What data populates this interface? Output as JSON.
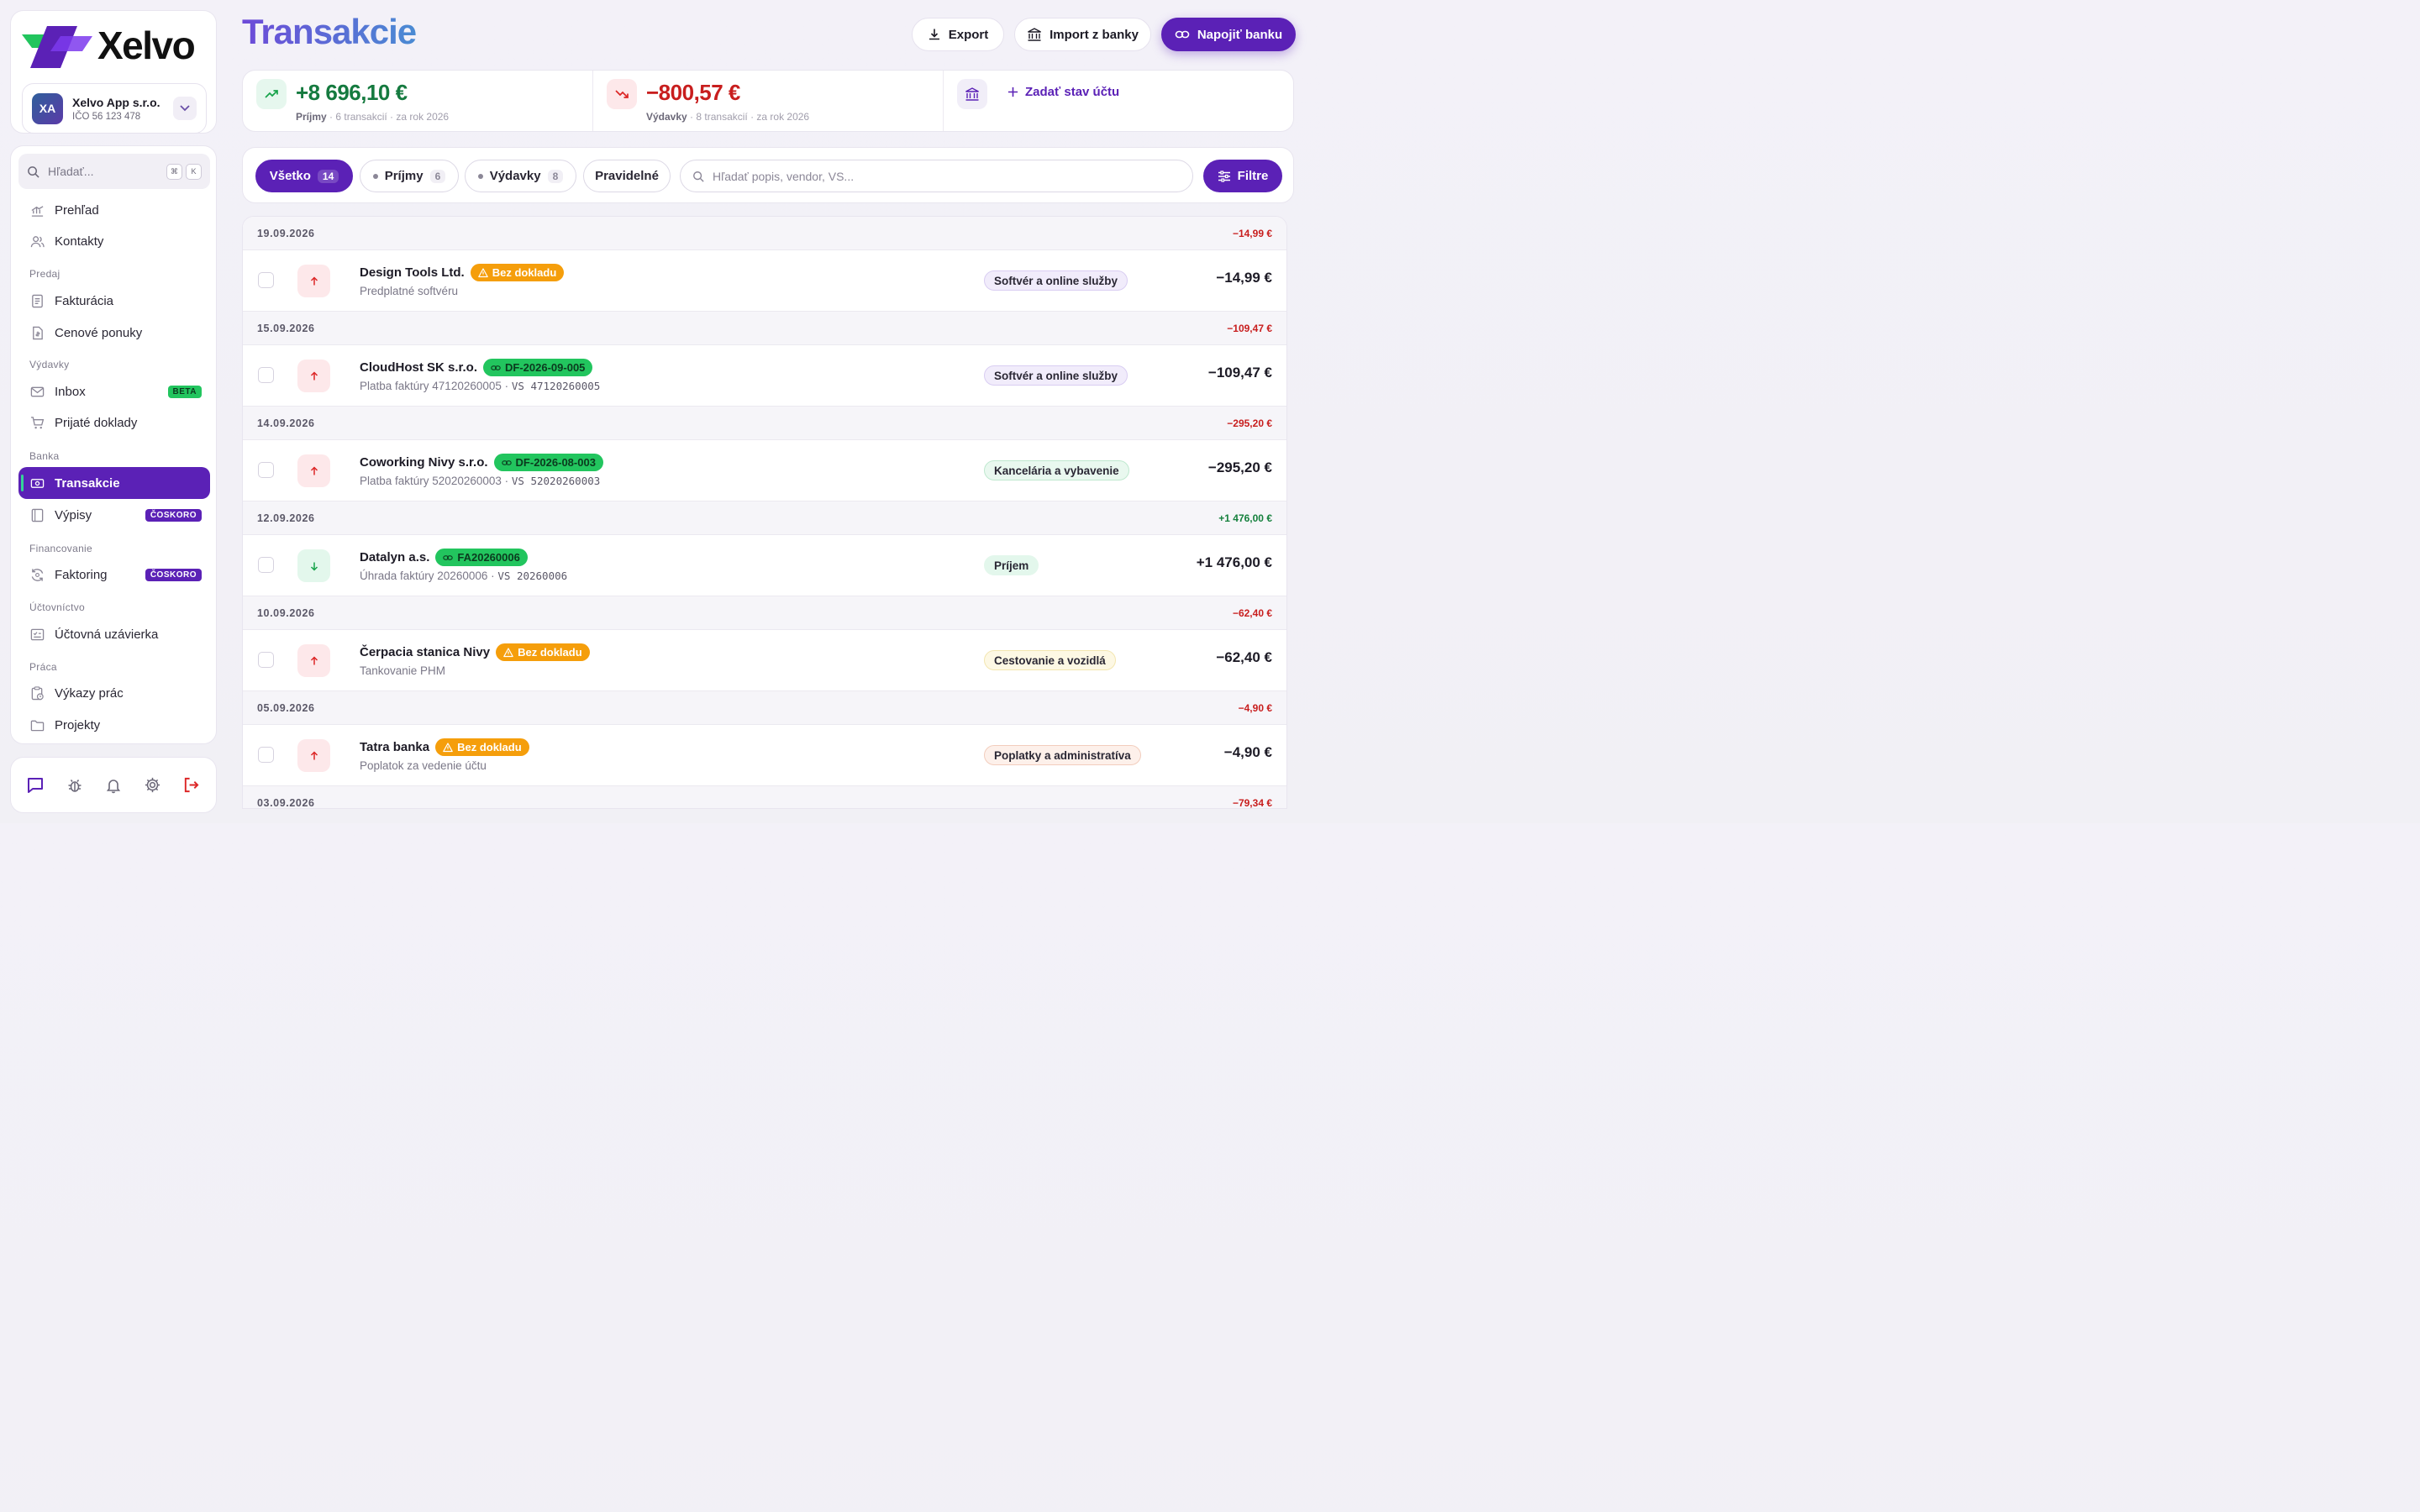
{
  "app": {
    "logo_text": "Xelvo",
    "company": {
      "initials": "XA",
      "name": "Xelvo App s.r.o.",
      "ico": "IČO 56 123 478"
    },
    "search": {
      "placeholder": "Hľadať...",
      "kbd1": "⌘",
      "kbd2": "K"
    }
  },
  "nav": {
    "overview": "Prehľad",
    "contacts": "Kontakty",
    "section_sales": "Predaj",
    "invoicing": "Fakturácia",
    "quotes": "Cenové ponuky",
    "section_expenses": "Výdavky",
    "inbox": "Inbox",
    "inbox_badge": "BETA",
    "received_docs": "Prijaté doklady",
    "section_bank": "Banka",
    "transactions": "Transakcie",
    "statements": "Výpisy",
    "statements_badge": "ČOSKORO",
    "section_financing": "Financovanie",
    "factoring": "Faktoring",
    "factoring_badge": "ČOSKORO",
    "section_accounting": "Účtovníctvo",
    "closing": "Účtovná uzávierka",
    "section_work": "Práca",
    "timesheets": "Výkazy prác",
    "projects": "Projekty"
  },
  "header": {
    "title": "Transakcie",
    "export_label": "Export",
    "import_label": "Import z banky",
    "connect_label": "Napojiť banku"
  },
  "summary": {
    "income_value": "+8 696,10 €",
    "income_label": "Príjmy",
    "income_meta": "· 6 transakcií · za rok 2026",
    "expense_value": "−800,57 €",
    "expense_label": "Výdavky",
    "expense_meta": "· 8 transakcií · za rok 2026",
    "balance_action": "Zadať stav účtu"
  },
  "filters": {
    "all_label": "Všetko",
    "all_count": "14",
    "income_label": "Príjmy",
    "income_count": "6",
    "expense_label": "Výdavky",
    "expense_count": "8",
    "recurring_label": "Pravidelné",
    "search_placeholder": "Hľadať popis, vendor, VS...",
    "filter_button": "Filtre"
  },
  "groups": [
    {
      "date": "19.09.2026",
      "total": "−14,99 €",
      "total_color": "#c81e1e",
      "tx": {
        "vendor": "Design Tools Ltd.",
        "tag_type": "warn",
        "tag": "Bez dokladu",
        "desc": "Predplatné softvéru",
        "vs": "",
        "direction": "out",
        "category": "Softvér a online služby",
        "cat_bg": "#f1ecfb",
        "cat_border": "#d9cdf2",
        "amount": "−14,99 €"
      }
    },
    {
      "date": "15.09.2026",
      "total": "−109,47 €",
      "total_color": "#c81e1e",
      "tx": {
        "vendor": "CloudHost SK s.r.o.",
        "tag_type": "link",
        "tag": "DF-2026-09-005",
        "desc": "Platba faktúry 47120260005  ·",
        "vs": "VS 47120260005",
        "direction": "out",
        "category": "Softvér a online služby",
        "cat_bg": "#f1ecfb",
        "cat_border": "#d9cdf2",
        "amount": "−109,47 €"
      }
    },
    {
      "date": "14.09.2026",
      "total": "−295,20 €",
      "total_color": "#c81e1e",
      "tx": {
        "vendor": "Coworking Nivy s.r.o.",
        "tag_type": "link",
        "tag": "DF-2026-08-003",
        "desc": "Platba faktúry 52020260003  ·",
        "vs": "VS 52020260003",
        "direction": "out",
        "category": "Kancelária a vybavenie",
        "cat_bg": "#e9f8ef",
        "cat_border": "#bfe8cf",
        "amount": "−295,20 €"
      }
    },
    {
      "date": "12.09.2026",
      "total": "+1 476,00 €",
      "total_color": "#15803d",
      "tx": {
        "vendor": "Datalyn a.s.",
        "tag_type": "link",
        "tag": "FA20260006",
        "desc": "Úhrada faktúry 20260006  ·",
        "vs": "VS 20260006",
        "direction": "in",
        "category": "Príjem",
        "cat_bg": "#e3f7ec",
        "cat_border": "#e3f7ec",
        "amount": "+1 476,00 €"
      }
    },
    {
      "date": "10.09.2026",
      "total": "−62,40 €",
      "total_color": "#c81e1e",
      "tx": {
        "vendor": "Čerpacia stanica Nivy",
        "tag_type": "warn",
        "tag": "Bez dokladu",
        "desc": "Tankovanie PHM",
        "vs": "",
        "direction": "out",
        "category": "Cestovanie a vozidlá",
        "cat_bg": "#fdf8e4",
        "cat_border": "#f3e6b0",
        "amount": "−62,40 €"
      }
    },
    {
      "date": "05.09.2026",
      "total": "−4,90 €",
      "total_color": "#c81e1e",
      "tx": {
        "vendor": "Tatra banka",
        "tag_type": "warn",
        "tag": "Bez dokladu",
        "desc": "Poplatok za vedenie účtu",
        "vs": "",
        "direction": "out",
        "category": "Poplatky a administratíva",
        "cat_bg": "#fdf0ea",
        "cat_border": "#f2cdbd",
        "amount": "−4,90 €"
      }
    },
    {
      "date": "03.09.2026",
      "total": "−79,34 €",
      "total_color": "#c81e1e"
    }
  ]
}
